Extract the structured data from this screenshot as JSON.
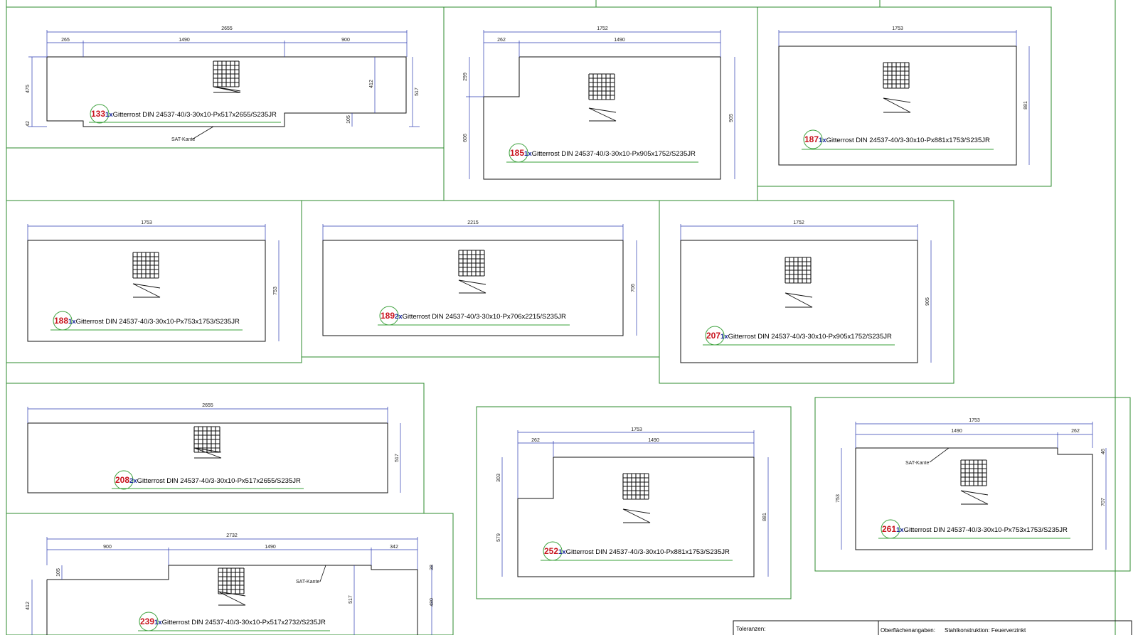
{
  "drawing": {
    "colors": {
      "frame": "#2e8b2e",
      "dimension": "#2b3bb0",
      "outline": "#111111",
      "position": "#c8141e",
      "quantity": "#1a2a9a",
      "underline": "#3aa03a"
    },
    "sat_label": "SAT-Kante",
    "parts": [
      {
        "pos": "133",
        "qty": "1x",
        "spec": "Gitterrost DIN 24537-40/3-30x10-Px517x2655/S235JR",
        "dims": {
          "total_width": "2655",
          "segments": [
            "265",
            "1490",
            "900"
          ],
          "height": "517",
          "left_main": "475",
          "left_step": "42",
          "right_inner": "412",
          "right_small": "105"
        },
        "sat": true
      },
      {
        "pos": "185",
        "qty": "1x",
        "spec": "Gitterrost DIN 24537-40/3-30x10-Px905x1752/S235JR",
        "dims": {
          "total_width": "1752",
          "segments": [
            "262",
            "1490"
          ],
          "height": "905",
          "left_upper": "299",
          "left_lower": "606"
        }
      },
      {
        "pos": "187",
        "qty": "1x",
        "spec": "Gitterrost DIN 24537-40/3-30x10-Px881x1753/S235JR",
        "dims": {
          "total_width": "1753",
          "height": "881"
        }
      },
      {
        "pos": "188",
        "qty": "1x",
        "spec": "Gitterrost DIN 24537-40/3-30x10-Px753x1753/S235JR",
        "dims": {
          "total_width": "1753",
          "height": "753"
        }
      },
      {
        "pos": "189",
        "qty": "2x",
        "spec": "Gitterrost DIN 24537-40/3-30x10-Px706x2215/S235JR",
        "dims": {
          "total_width": "2215",
          "height": "706"
        }
      },
      {
        "pos": "207",
        "qty": "1x",
        "spec": "Gitterrost DIN 24537-40/3-30x10-Px905x1752/S235JR",
        "dims": {
          "total_width": "1752",
          "height": "905"
        }
      },
      {
        "pos": "208",
        "qty": "2x",
        "spec": "Gitterrost DIN 24537-40/3-30x10-Px517x2655/S235JR",
        "dims": {
          "total_width": "2655",
          "height": "517"
        }
      },
      {
        "pos": "239",
        "qty": "1x",
        "spec": "Gitterrost DIN 24537-40/3-30x10-Px517x2732/S235JR",
        "dims": {
          "total_width": "2732",
          "segments": [
            "900",
            "1490",
            "342"
          ],
          "height": "517",
          "left_main": "412",
          "left_step": "105",
          "right_main": "480",
          "right_step": "38"
        },
        "sat": true
      },
      {
        "pos": "252",
        "qty": "1x",
        "spec": "Gitterrost DIN 24537-40/3-30x10-Px881x1753/S235JR",
        "dims": {
          "total_width": "1753",
          "segments": [
            "262",
            "1490"
          ],
          "height": "881",
          "left_upper": "303",
          "left_lower": "579"
        }
      },
      {
        "pos": "261",
        "qty": "1x",
        "spec": "Gitterrost DIN 24537-40/3-30x10-Px753x1753/S235JR",
        "dims": {
          "total_width": "1753",
          "segments": [
            "1490",
            "262"
          ],
          "height": "753",
          "right_small": "46",
          "right_main": "707"
        },
        "sat": true
      }
    ],
    "title_block": {
      "tolerances_label": "Toleranzen:",
      "surface_label": "Oberflächenangaben:",
      "surface_value": "Stahlkonstruktion: Feuerverzinkt"
    }
  }
}
